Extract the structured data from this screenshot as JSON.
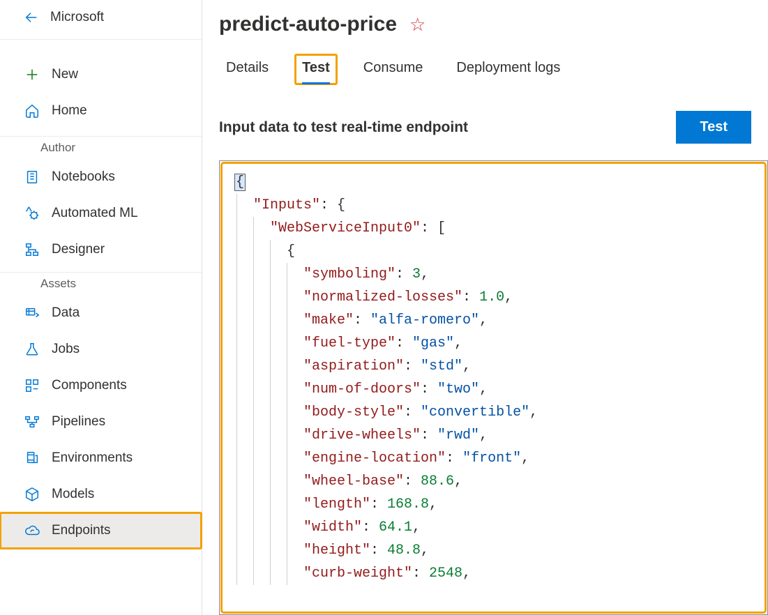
{
  "sidebar": {
    "back_label": "Microsoft",
    "new_label": "New",
    "home_label": "Home",
    "section_author": "Author",
    "section_assets": "Assets",
    "items": {
      "notebooks": "Notebooks",
      "automated_ml": "Automated ML",
      "designer": "Designer",
      "data": "Data",
      "jobs": "Jobs",
      "components": "Components",
      "pipelines": "Pipelines",
      "environments": "Environments",
      "models": "Models",
      "endpoints": "Endpoints"
    }
  },
  "header": {
    "title": "predict-auto-price"
  },
  "tabs": {
    "details": "Details",
    "test": "Test",
    "consume": "Consume",
    "deployment_logs": "Deployment logs"
  },
  "test_panel": {
    "subtitle": "Input data to test real-time endpoint",
    "button": "Test"
  },
  "code": {
    "inputs_key": "\"Inputs\"",
    "ws_key": "\"WebServiceInput0\"",
    "fields": {
      "symboling": {
        "k": "\"symboling\"",
        "v": "3",
        "t": "n"
      },
      "normalized_losses": {
        "k": "\"normalized-losses\"",
        "v": "1.0",
        "t": "n"
      },
      "make": {
        "k": "\"make\"",
        "v": "\"alfa-romero\"",
        "t": "s"
      },
      "fuel_type": {
        "k": "\"fuel-type\"",
        "v": "\"gas\"",
        "t": "s"
      },
      "aspiration": {
        "k": "\"aspiration\"",
        "v": "\"std\"",
        "t": "s"
      },
      "num_of_doors": {
        "k": "\"num-of-doors\"",
        "v": "\"two\"",
        "t": "s"
      },
      "body_style": {
        "k": "\"body-style\"",
        "v": "\"convertible\"",
        "t": "s"
      },
      "drive_wheels": {
        "k": "\"drive-wheels\"",
        "v": "\"rwd\"",
        "t": "s"
      },
      "engine_location": {
        "k": "\"engine-location\"",
        "v": "\"front\"",
        "t": "s"
      },
      "wheel_base": {
        "k": "\"wheel-base\"",
        "v": "88.6",
        "t": "n"
      },
      "length": {
        "k": "\"length\"",
        "v": "168.8",
        "t": "n"
      },
      "width": {
        "k": "\"width\"",
        "v": "64.1",
        "t": "n"
      },
      "height": {
        "k": "\"height\"",
        "v": "48.8",
        "t": "n"
      },
      "curb_weight": {
        "k": "\"curb-weight\"",
        "v": "2548",
        "t": "n"
      }
    }
  }
}
